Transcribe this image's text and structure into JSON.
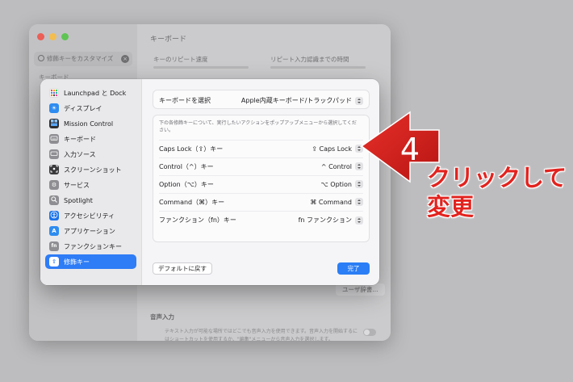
{
  "background_window": {
    "search_placeholder": "修飾キーをカスタマイズ",
    "sidebar_partial_item": "キーボード",
    "title": "キーボード",
    "key_repeat_label": "キーのリピート速度",
    "repeat_delay_label": "リピート入力認識までの時間",
    "user_dictionary_button": "ユーザ辞書...",
    "voice_input_heading": "音声入力",
    "voice_input_desc": "テキスト入力が可能な場所ではどこでも音声入力を使用できます。音声入力を開始するにはショートカットを使用するか、\"編集\"メニューから音声入力を選択します。"
  },
  "sidebar": {
    "items": [
      {
        "label": "Launchpad と Dock",
        "icon": "launchpad-icon",
        "color": "#ffffff"
      },
      {
        "label": "ディスプレイ",
        "icon": "display-icon",
        "color": "#2e8cf0"
      },
      {
        "label": "Mission Control",
        "icon": "mission-control-icon",
        "color": "#2d2d30"
      },
      {
        "label": "キーボード",
        "icon": "keyboard-icon",
        "color": "#8e8e93"
      },
      {
        "label": "入力ソース",
        "icon": "input-source-icon",
        "color": "#8e8e93"
      },
      {
        "label": "スクリーンショット",
        "icon": "screenshot-icon",
        "color": "#3a3a3d"
      },
      {
        "label": "サービス",
        "icon": "services-icon",
        "color": "#8e8e93"
      },
      {
        "label": "Spotlight",
        "icon": "spotlight-icon",
        "color": "#8e8e93"
      },
      {
        "label": "アクセシビリティ",
        "icon": "accessibility-icon",
        "color": "#1a73e8"
      },
      {
        "label": "アプリケーション",
        "icon": "applications-icon",
        "color": "#2e8cf0"
      },
      {
        "label": "ファンクションキー",
        "icon": "function-key-icon",
        "color": "#8e8e93"
      },
      {
        "label": "修飾キー",
        "icon": "modifier-key-icon",
        "color": "#ffffff"
      }
    ],
    "selected": "修飾キー"
  },
  "keyboard_select": {
    "label": "キーボードを選択",
    "value": "Apple内蔵キーボード/トラックパッド"
  },
  "modifier_keys": {
    "description": "下の各修飾キーについて、実行したいアクションをポップアップメニューから選択してください。",
    "rows": [
      {
        "label": "Caps Lock（⇪）キー",
        "value": "⇪ Caps Lock"
      },
      {
        "label": "Control（^）キー",
        "value": "^ Control"
      },
      {
        "label": "Option（⌥）キー",
        "value": "⌥ Option"
      },
      {
        "label": "Command（⌘）キー",
        "value": "⌘ Command"
      },
      {
        "label": "ファンクション（fn）キー",
        "value": "fn ファンクション"
      }
    ]
  },
  "buttons": {
    "restore_defaults": "デフォルトに戻す",
    "done": "完了"
  },
  "annotation": {
    "step_number": "4",
    "line1": "クリックして",
    "line2": "変更",
    "color": "#e2231f"
  }
}
